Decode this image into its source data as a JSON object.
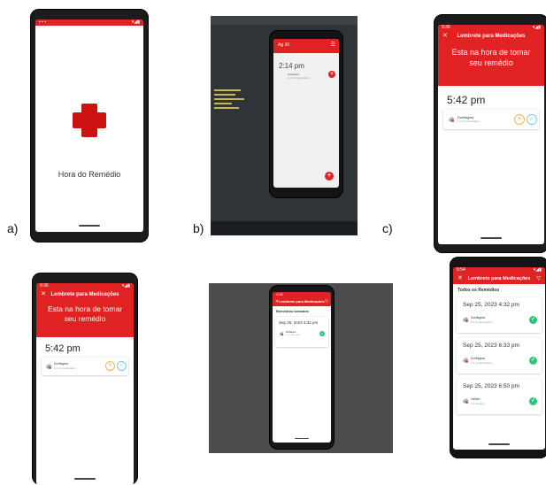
{
  "labels": {
    "a": "a)",
    "b": "b)",
    "c": "c)"
  },
  "splash": {
    "app_name": "Hora do Remédio"
  },
  "editor": {
    "date_title": "Ag 30",
    "time": "2:14 pm",
    "med_name": "Geladeira",
    "med_dose": "1.0 Comprimido(s)"
  },
  "reminder": {
    "time": "9:36",
    "title": "Lembrete para Medicações",
    "banner": "Esta na hora de tomar seu remédio",
    "dose_time": "5:42 pm",
    "med_name": "Dorflagina",
    "med_dose": "1.0 Comprimido(s)"
  },
  "reminder2": {
    "time": "9:36",
    "title": "Lembrete para Medicações",
    "banner": "Esta na hora de tomar seu remédio",
    "dose_time": "5:42 pm",
    "med_name": "Dorflagina",
    "med_dose": "1.0 Comprimido(s)"
  },
  "taken": {
    "time": "4:32",
    "title": "Lembrete para Medicações",
    "section": "Remédios tomados",
    "entries": [
      {
        "datetime": "Sep 25, 2023 4:32 pm",
        "med_name": "Dorflagina",
        "med_dose": "1.0 Comprimido(s)"
      }
    ]
  },
  "all": {
    "time": "6:54",
    "title": "Lembrete para Medicações",
    "section": "Todos os Remédios",
    "entries": [
      {
        "datetime": "Sep 25, 2023 4:32 pm",
        "med_name": "Dorflagina",
        "med_dose": "1.0 Comprimido(s)"
      },
      {
        "datetime": "Sep 25, 2023 6:33 pm",
        "med_name": "Dorflagina",
        "med_dose": "1.0 Comprimido(s)"
      },
      {
        "datetime": "Sep 25, 2023 6:50 pm",
        "med_name": "Valium",
        "med_dose": "1.0 Gota(s)"
      }
    ]
  },
  "icons": {
    "close": "close-icon",
    "filter": "filter-icon",
    "check": "check-icon",
    "cancel": "x-icon",
    "pill": "pill-icon",
    "add": "add-icon",
    "red_cross": "red-cross-logo"
  },
  "colors": {
    "brand_red": "#e02222",
    "check_green": "#2ec27e",
    "cancel_orange": "#f0b34a",
    "confirm_blue": "#7fc9e8",
    "phone_frame": "#1c1c1c"
  }
}
